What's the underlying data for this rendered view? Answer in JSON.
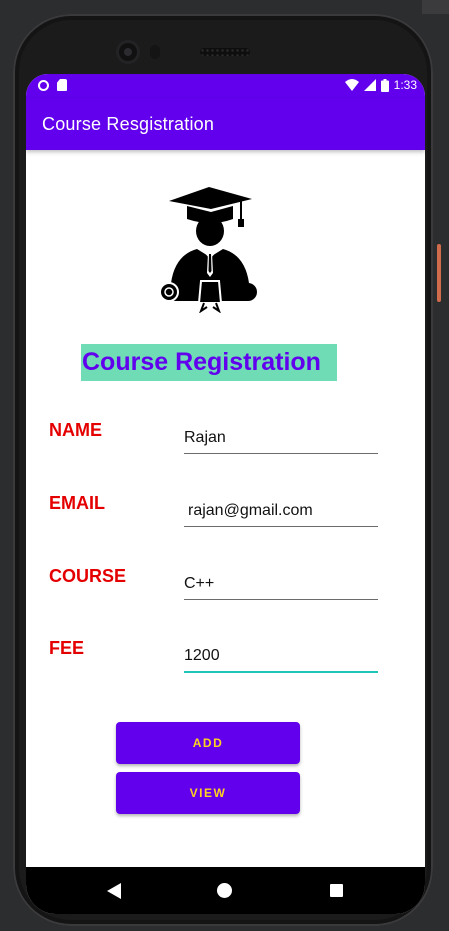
{
  "status_bar": {
    "time": "1:33",
    "icons": [
      "circle-notification-icon",
      "sd-card-icon",
      "wifi-icon",
      "cell-signal-icon",
      "battery-icon"
    ]
  },
  "app_bar": {
    "title": "Course Resgistration"
  },
  "graphic": {
    "icon": "graduate-icon"
  },
  "heading": {
    "text": "Course Registration"
  },
  "form": {
    "name": {
      "label": "NAME",
      "value": "Rajan"
    },
    "email": {
      "label": "EMAIL",
      "value": "rajan@gmail.com"
    },
    "course": {
      "label": "COURSE",
      "value": "C++"
    },
    "fee": {
      "label": "FEE",
      "value": "1200"
    }
  },
  "buttons": {
    "add": "ADD",
    "view": "VIEW"
  },
  "nav": {
    "icons": [
      "back-icon",
      "home-icon",
      "recents-icon"
    ]
  },
  "colors": {
    "primary": "#6200ee",
    "label_red": "#e50000",
    "heading_bg": "#6fdcb6",
    "button_text": "#ffd21f",
    "focus_underline": "#1fc6b8"
  }
}
